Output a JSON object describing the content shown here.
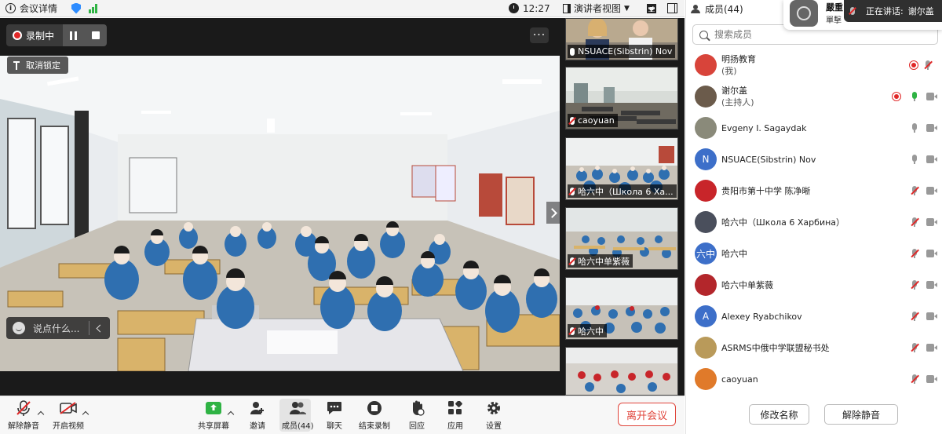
{
  "topbar": {
    "meeting_info_label": "会议详情",
    "time": "12:27",
    "view_mode_label": "演讲者视图"
  },
  "stage": {
    "recording_label": "录制中",
    "unlock_label": "取消锁定",
    "chat_placeholder": "说点什么...",
    "more_label": "···"
  },
  "thumbnails": [
    {
      "name": "NSUACE(Sibstrin) Nov",
      "muted": false
    },
    {
      "name": "caoyuan",
      "muted": true
    },
    {
      "name": "哈六中（Школа 6 Ха...",
      "muted": true
    },
    {
      "name": "哈六中单紫薇",
      "muted": true
    },
    {
      "name": "哈六中",
      "muted": true
    },
    {
      "name": "",
      "muted": true
    }
  ],
  "toolbar": {
    "unmute_label": "解除静音",
    "start_video_label": "开启视频",
    "share_screen_label": "共享屏幕",
    "invite_label": "邀请",
    "members_label": "成员(44)",
    "chat_label": "聊天",
    "stop_recording_label": "结束录制",
    "reactions_label": "回应",
    "apps_label": "应用",
    "settings_label": "设置",
    "leave_label": "离开会议"
  },
  "panel": {
    "title": "成员(44)",
    "search_placeholder": "搜索成员",
    "rename_label": "修改名称",
    "unmute_label": "解除静音",
    "participants": [
      {
        "name": "明扬教育",
        "sub": "(我)",
        "avatar_text": "",
        "avatar_color": "#d8443a",
        "recording": true,
        "mic": "muted",
        "cam": "muted"
      },
      {
        "name": "谢尔盖",
        "sub": "(主持人)",
        "avatar_text": "",
        "avatar_color": "#6b5b4b",
        "recording": true,
        "mic": "green",
        "cam": "on"
      },
      {
        "name": "Evgeny I. Sagaydak",
        "sub": "",
        "avatar_text": "",
        "avatar_color": "#8a8a7a",
        "recording": false,
        "mic": "on",
        "cam": "on"
      },
      {
        "name": "NSUACE(Sibstrin) Nov",
        "sub": "",
        "avatar_text": "N",
        "avatar_color": "#3d6fc9",
        "recording": false,
        "mic": "on",
        "cam": "on"
      },
      {
        "name": "贵阳市第十中学 陈净晰",
        "sub": "",
        "avatar_text": "",
        "avatar_color": "#c8252a",
        "recording": false,
        "mic": "muted",
        "cam": "on"
      },
      {
        "name": "哈六中（Школа 6 Харбина）",
        "sub": "",
        "avatar_text": "",
        "avatar_color": "#4a4f5c",
        "recording": false,
        "mic": "muted",
        "cam": "on"
      },
      {
        "name": "哈六中",
        "sub": "",
        "avatar_text": "六中",
        "avatar_color": "#3d6fc9",
        "recording": false,
        "mic": "muted",
        "cam": "on"
      },
      {
        "name": "哈六中单紫薇",
        "sub": "",
        "avatar_text": "",
        "avatar_color": "#b3262b",
        "recording": false,
        "mic": "muted",
        "cam": "on"
      },
      {
        "name": "Alexey Ryabchikov",
        "sub": "",
        "avatar_text": "A",
        "avatar_color": "#3d6fc9",
        "recording": false,
        "mic": "muted",
        "cam": "on"
      },
      {
        "name": "ASRMS中俄中学联盟秘书处",
        "sub": "",
        "avatar_text": "",
        "avatar_color": "#b99a5a",
        "recording": false,
        "mic": "muted",
        "cam": "on"
      },
      {
        "name": "caoyuan",
        "sub": "",
        "avatar_text": "",
        "avatar_color": "#e07a2a",
        "recording": false,
        "mic": "muted",
        "cam": "on"
      }
    ]
  },
  "notification": {
    "title": "嚴重",
    "text": "單擊",
    "speaking_label": "正在讲话:",
    "speaker_name": "谢尔盖"
  },
  "colors": {
    "accent": "#2d8cff",
    "recording_red": "#e02828",
    "leave_red": "#e0453b",
    "unmuted_green": "#2fb344"
  }
}
